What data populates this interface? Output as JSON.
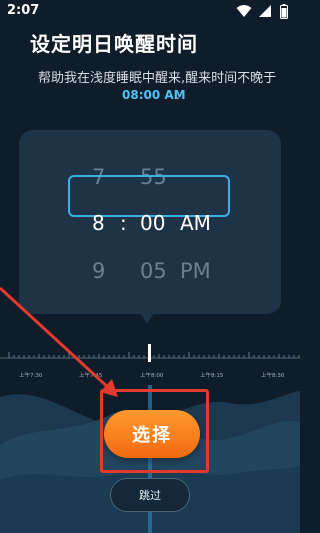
{
  "status_bar": {
    "time": "2:07"
  },
  "header": {
    "title": "设定明日唤醒时间",
    "subtitle": "帮助我在浅度睡眠中醒来,醒来时间不晚于",
    "deadline_time": "08:00 AM",
    "deadline_suffix": "."
  },
  "picker": {
    "above": {
      "hour": "7",
      "minute": "55"
    },
    "selected": {
      "hour": "8",
      "separator": ":",
      "minute": "00",
      "period": "AM"
    },
    "below": {
      "hour": "9",
      "minute": "05",
      "period": "PM"
    }
  },
  "ruler": {
    "labels": [
      "上午7:30",
      "上午7:45",
      "上午8:00",
      "上午8:15",
      "上午8:30"
    ]
  },
  "actions": {
    "select_label": "选择",
    "skip_label": "跳过"
  },
  "colors": {
    "accent_blue": "#39b0ec",
    "button_orange": "#f36a10",
    "annotation_red": "#e23b2e",
    "background": "#0f1d2b"
  }
}
